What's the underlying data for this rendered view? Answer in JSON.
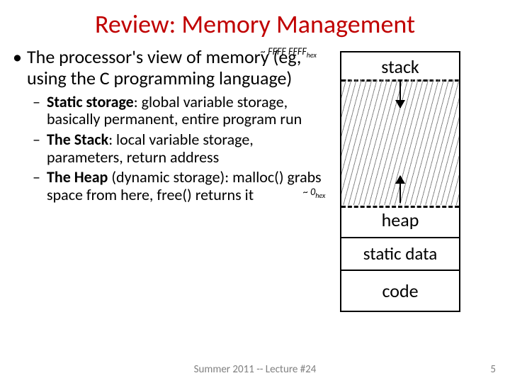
{
  "title": "Review: Memory Management",
  "main_bullet": "The processor's view of memory (eg, using the C programming language)",
  "sub1_label": "Static storage",
  "sub1_rest": ": global variable storage, basically permanent, entire program run",
  "sub2_label": "The Stack",
  "sub2_rest": ": local variable storage, parameters, return address",
  "sub3_label": "The Heap",
  "sub3_paren": " (dynamic storage): ",
  "sub3_rest": "malloc() grabs space from here, free() returns it",
  "diagram": {
    "addr_top": "~ FFFF FFFF",
    "addr_top_sub": "hex",
    "addr_bot": "~ 0",
    "addr_bot_sub": "hex",
    "stack": "stack",
    "heap": "heap",
    "static": "static data",
    "code": "code"
  },
  "footer_center": "Summer 2011 -- Lecture #24",
  "footer_right": "5"
}
